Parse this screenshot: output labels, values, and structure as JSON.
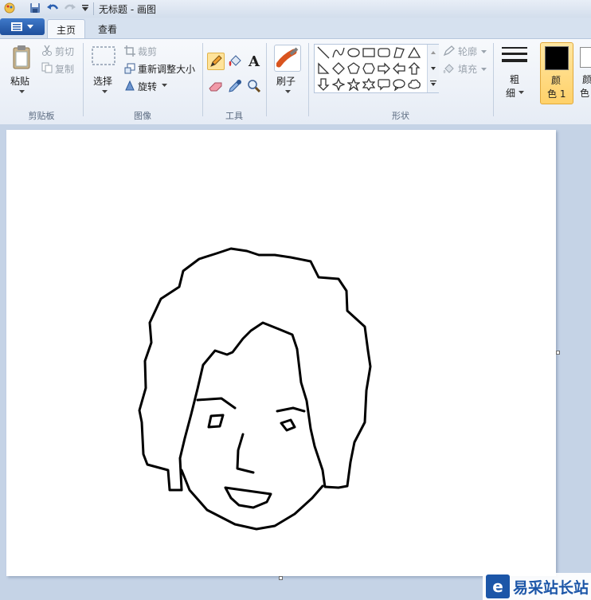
{
  "window": {
    "title": "无标题 - 画图"
  },
  "tabs": [
    {
      "label": "主页",
      "active": true
    },
    {
      "label": "查看",
      "active": false
    }
  ],
  "clipboard": {
    "paste_label": "粘贴",
    "cut_label": "剪切",
    "copy_label": "复制",
    "group_label": "剪贴板"
  },
  "image": {
    "select_label": "选择",
    "crop_label": "裁剪",
    "resize_label": "重新调整大小",
    "rotate_label": "旋转",
    "group_label": "图像"
  },
  "tools": {
    "group_label": "工具"
  },
  "brushes": {
    "label": "刷子"
  },
  "shapes": {
    "outline_label": "轮廓",
    "fill_label": "填充",
    "group_label": "形状"
  },
  "size": {
    "label_1": "粗",
    "label_2": "细"
  },
  "colors": {
    "color1_label_1": "颜",
    "color1_label_2": "色 1",
    "color1_value": "#000000",
    "color2_label_1": "颜",
    "color2_label_2": "色",
    "color2_value": "#ffffff",
    "accent": "#1c56a8"
  },
  "watermark": {
    "text": "易采站长站"
  },
  "icons": [
    "save-icon",
    "undo-icon",
    "redo-icon",
    "customize-icon",
    "paste-icon",
    "cut-icon",
    "copy-icon",
    "select-icon",
    "crop-icon",
    "resize-icon",
    "rotate-icon",
    "pencil-icon",
    "fill-icon",
    "text-icon",
    "eraser-icon",
    "color-picker-icon",
    "magnifier-icon",
    "brush-icon",
    "size-icon"
  ]
}
